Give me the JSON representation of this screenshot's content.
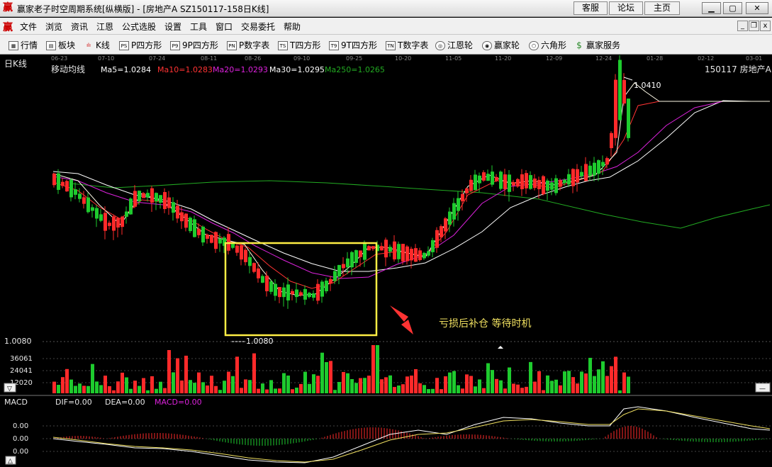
{
  "window": {
    "title": "赢家老子时空周期系统[纵横版] - [房地产A  SZ150117-158日K线]",
    "buttons": {
      "service": "客服",
      "forum": "论坛",
      "home": "主页"
    }
  },
  "menu": [
    "文件",
    "浏览",
    "资讯",
    "江恩",
    "公式选股",
    "设置",
    "工具",
    "窗口",
    "交易委托",
    "帮助"
  ],
  "toolbar": [
    {
      "label": "行情",
      "icon": "grid-icon"
    },
    {
      "label": "板块",
      "icon": "blocks-icon"
    },
    {
      "label": "K线",
      "icon": "candles-icon"
    },
    {
      "label": "P四方形",
      "icon": "PS"
    },
    {
      "label": "9P四方形",
      "icon": "P9"
    },
    {
      "label": "P数字表",
      "icon": "PN"
    },
    {
      "label": "T四方形",
      "icon": "TS"
    },
    {
      "label": "9T四方形",
      "icon": "T9"
    },
    {
      "label": "T数字表",
      "icon": "TN"
    },
    {
      "label": "江恩轮",
      "icon": "wheel-icon"
    },
    {
      "label": "赢家轮",
      "icon": "wheel-icon"
    },
    {
      "label": "六角形",
      "icon": "hexagon-icon"
    },
    {
      "label": "赢家服务",
      "icon": "dollar-icon"
    }
  ],
  "chart": {
    "period_label": "日K线",
    "indicator_name": "移动均线",
    "ma_labels": [
      "Ma5=1.0284",
      "Ma10=1.0283",
      "Ma20=1.0293",
      "Ma30=1.0295",
      "Ma250=1.0265"
    ],
    "symbol": "150117 房地产A",
    "dates": [
      "06-23",
      "07-10",
      "07-24",
      "08-11",
      "08-26",
      "09-10",
      "09-25",
      "10-20",
      "11-05",
      "11-20",
      "12-09",
      "12-24",
      "01-28",
      "02-12",
      "03-01"
    ],
    "high_label": "1.0410",
    "low_label": "1.0080",
    "price_axis_label": "1.0080",
    "annotation": "亏损后补仓 等待时机",
    "volume_ticks": [
      "36061",
      "24041",
      "12020"
    ],
    "macd_header": {
      "name": "MACD",
      "dif": "DIF=0.00",
      "dea": "DEA=0.00",
      "macd": "MACD=0.00"
    },
    "macd_ticks": [
      "0.00",
      "0.00",
      "0.00",
      "0.00"
    ],
    "colors": {
      "up": "#ff2a2a",
      "down": "#1ecb2e",
      "ma5": "#ffffff",
      "ma10": "#ff3333",
      "ma20": "#dd22dd",
      "ma30": "#ffffff",
      "ma250": "#22aa22",
      "highlight": "#ffee44",
      "annotation": "#f0e060"
    }
  }
}
